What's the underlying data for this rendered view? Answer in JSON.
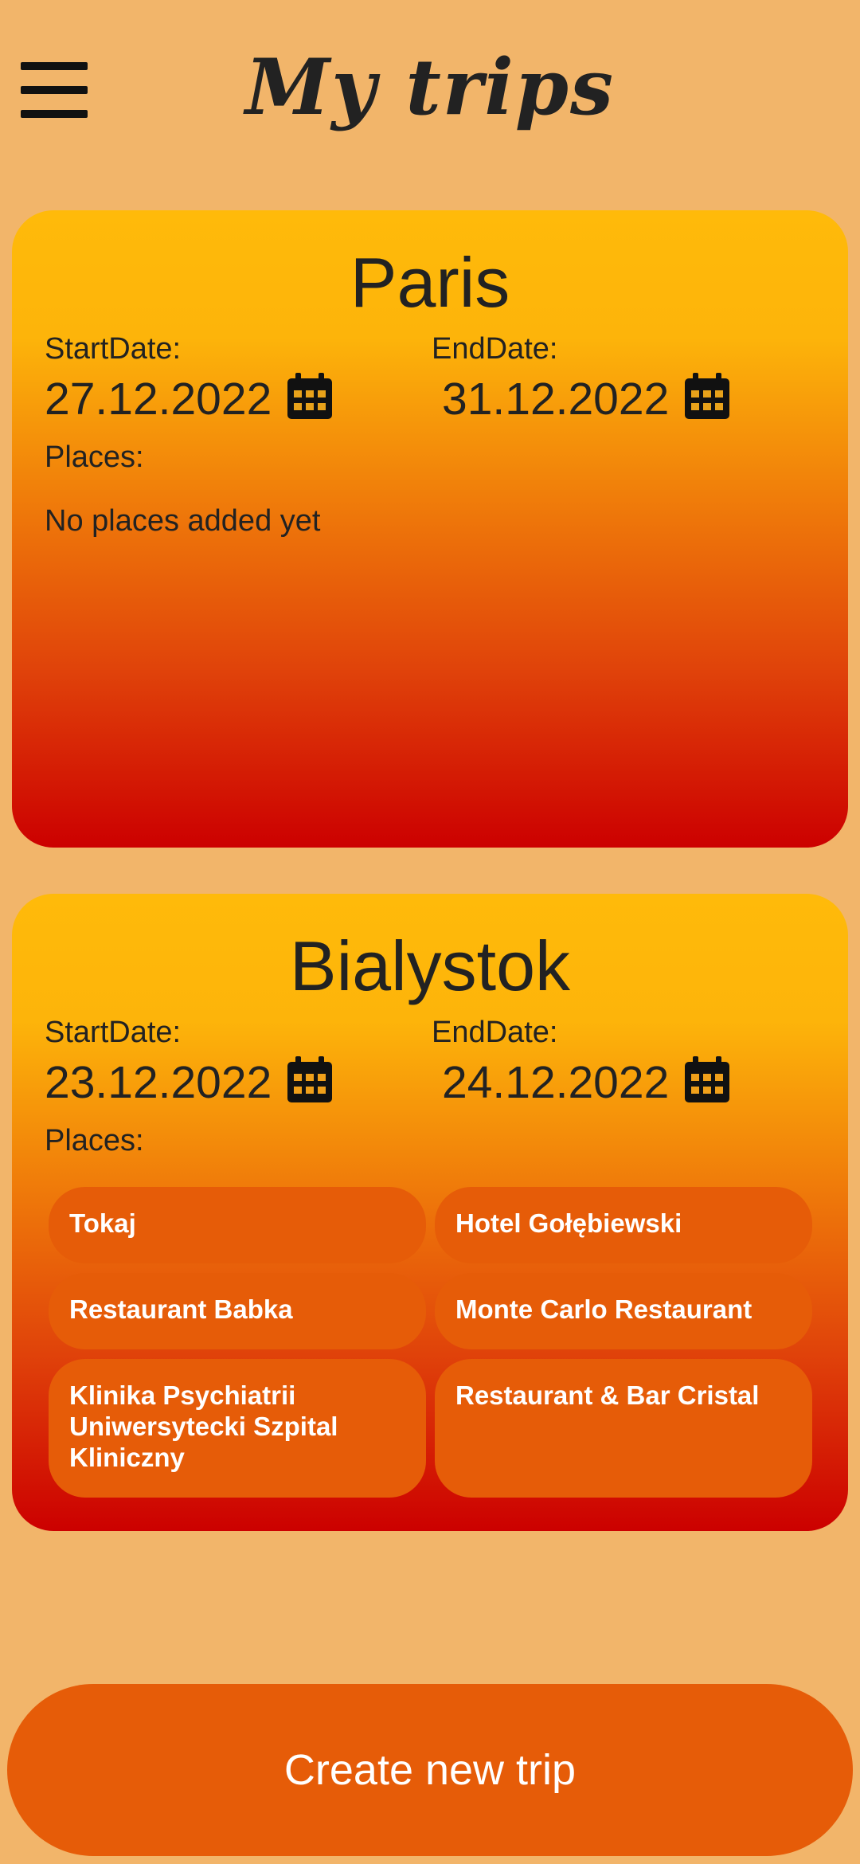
{
  "header": {
    "title": "My trips",
    "menu_icon": "hamburger-menu-icon"
  },
  "trips": [
    {
      "name": "Paris",
      "start_label": "StartDate:",
      "start_date": "27.12.2022",
      "end_label": "EndDate:",
      "end_date": "31.12.2022",
      "places_label": "Places:",
      "empty_text": "No places added yet",
      "places": []
    },
    {
      "name": "Bialystok",
      "start_label": "StartDate:",
      "start_date": "23.12.2022",
      "end_label": "EndDate:",
      "end_date": "24.12.2022",
      "places_label": "Places:",
      "places": [
        "Tokaj",
        "Hotel Gołębiewski",
        "Restaurant Babka",
        "Monte Carlo Restaurant",
        "Klinika Psychiatrii Uniwersytecki Szpital Kliniczny",
        "Restaurant & Bar Cristal"
      ]
    }
  ],
  "actions": {
    "create_label": "Create new trip"
  },
  "icons": {
    "calendar": "calendar-icon"
  },
  "colors": {
    "background": "#F2B56A",
    "card_top": "#FFBA0A",
    "card_bottom": "#CC0000",
    "accent": "#E65C08",
    "text": "#222222"
  }
}
